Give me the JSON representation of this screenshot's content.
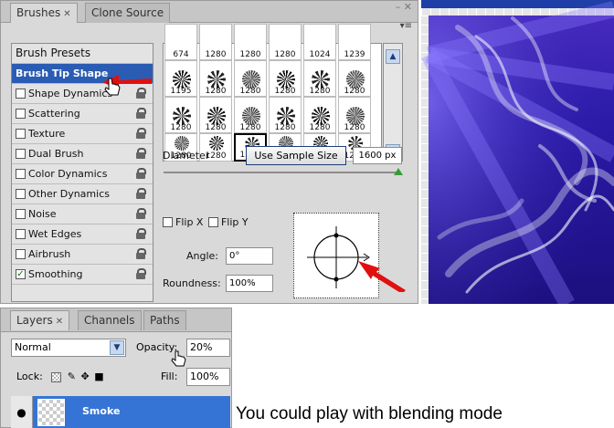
{
  "brushes": {
    "tabs": [
      {
        "label": "Brushes"
      },
      {
        "label": "Clone Source"
      }
    ],
    "options": [
      {
        "label": "Brush Presets",
        "type": "header"
      },
      {
        "label": "Brush Tip Shape",
        "type": "selected"
      },
      {
        "label": "Shape Dynamics",
        "checked": false
      },
      {
        "label": "Scattering",
        "checked": false
      },
      {
        "label": "Texture",
        "checked": false
      },
      {
        "label": "Dual Brush",
        "checked": false
      },
      {
        "label": "Color Dynamics",
        "checked": false
      },
      {
        "label": "Other Dynamics",
        "checked": false
      },
      {
        "label": "Noise",
        "checked": false
      },
      {
        "label": "Wet Edges",
        "checked": false
      },
      {
        "label": "Airbrush",
        "checked": false
      },
      {
        "label": "Smoothing",
        "checked": true
      }
    ],
    "top_row": [
      "674",
      "1280",
      "1280",
      "1280",
      "1024",
      "1239"
    ],
    "row1": [
      "1195",
      "1280",
      "1280",
      "1280",
      "1280",
      "1280"
    ],
    "row2": [
      "1280",
      "1280",
      "1280",
      "1280",
      "1280",
      "1280"
    ],
    "row3": [
      "1280",
      "1280",
      "1280",
      "1280",
      "1280",
      "1280"
    ],
    "diameter_label": "Diameter",
    "sample_button": "Use Sample Size",
    "diameter_value": "1600 px",
    "flip_x": "Flip X",
    "flip_y": "Flip Y",
    "angle_label": "Angle:",
    "angle_value": "0°",
    "roundness_label": "Roundness:",
    "roundness_value": "100%"
  },
  "layers": {
    "tabs": [
      {
        "label": "Layers"
      },
      {
        "label": "Channels"
      },
      {
        "label": "Paths"
      }
    ],
    "blend_mode": "Normal",
    "opacity_label": "Opacity:",
    "opacity_value": "20%",
    "lock_label": "Lock:",
    "fill_label": "Fill:",
    "fill_value": "100%",
    "layer_name": "Smoke"
  },
  "caption": "You could play with blending mode",
  "colors": {
    "selection": "#2b5cb3",
    "layer_selected": "#3574d4",
    "arrow": "#e01010",
    "canvas": "#2b1aa8"
  }
}
